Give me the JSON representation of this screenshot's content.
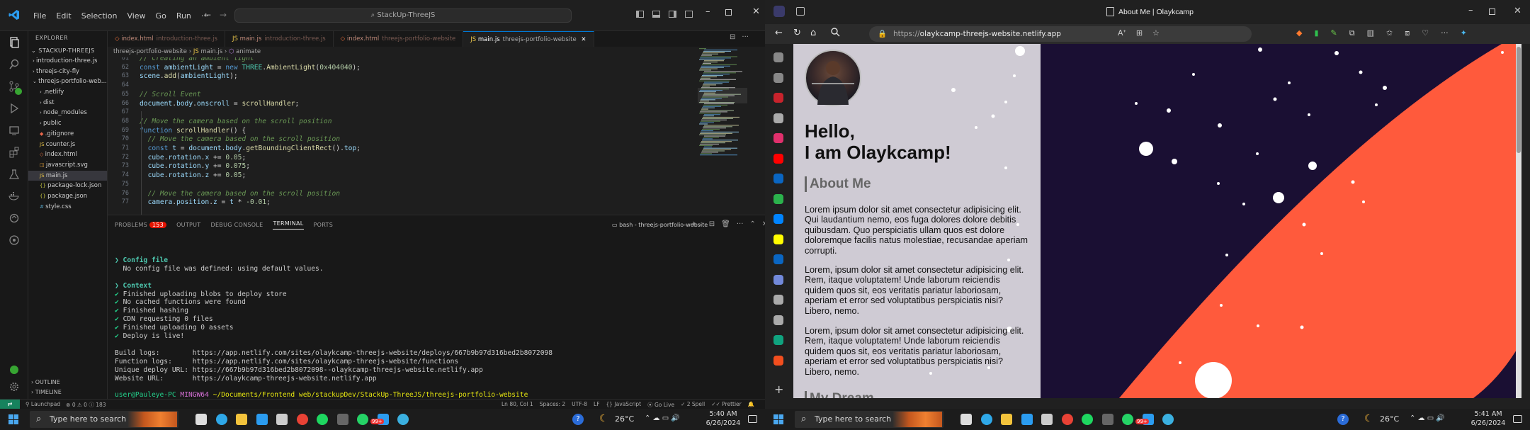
{
  "vscode": {
    "menu": [
      "File",
      "Edit",
      "Selection",
      "View",
      "Go",
      "Run"
    ],
    "more": "···",
    "command_center": "StackUp-ThreeJS",
    "explorer": {
      "title": "EXPLORER",
      "workspace": "STACKUP-THREEJS",
      "items": [
        {
          "label": "introduction-three.js",
          "kind": "folder",
          "depth": 0
        },
        {
          "label": "threejs-city-fly",
          "kind": "folder",
          "depth": 0
        },
        {
          "label": "threejs-portfolio-web...",
          "kind": "folder-open",
          "depth": 0
        },
        {
          "label": ".netlify",
          "kind": "folder",
          "depth": 1
        },
        {
          "label": "dist",
          "kind": "folder",
          "depth": 1
        },
        {
          "label": "node_modules",
          "kind": "folder",
          "depth": 1
        },
        {
          "label": "public",
          "kind": "folder",
          "depth": 1
        },
        {
          "label": ".gitignore",
          "kind": "file",
          "depth": 1
        },
        {
          "label": "counter.js",
          "kind": "js",
          "depth": 1
        },
        {
          "label": "index.html",
          "kind": "html",
          "depth": 1
        },
        {
          "label": "javascript.svg",
          "kind": "svg",
          "depth": 1
        },
        {
          "label": "main.js",
          "kind": "js",
          "depth": 1
        },
        {
          "label": "package-lock.json",
          "kind": "json",
          "depth": 1
        },
        {
          "label": "package.json",
          "kind": "json",
          "depth": 1
        },
        {
          "label": "style.css",
          "kind": "css",
          "depth": 1
        }
      ],
      "outline": "OUTLINE",
      "timeline": "TIMELINE"
    },
    "tabs": [
      {
        "name": "index.html",
        "folder": "introduction-three.js",
        "active": false
      },
      {
        "name": "main.js",
        "folder": "introduction-three.js",
        "active": false
      },
      {
        "name": "index.html",
        "folder": "threejs-portfolio-website",
        "active": false
      },
      {
        "name": "main.js",
        "folder": "threejs-portfolio-website",
        "active": true
      }
    ],
    "breadcrumb": [
      "threejs-portfolio-website",
      "main.js",
      "animate"
    ],
    "code_lines": [
      {
        "n": "61",
        "html": "<span class='cm'>// Creating an ambient light</span>"
      },
      {
        "n": "62",
        "html": "<span class='kw'>const</span> <span class='pr'>ambientLight</span> = <span class='kw'>new</span> <span class='cl'>THREE</span>.<span class='fn'>AmbientLight</span>(<span class='nm'>0x404040</span>);"
      },
      {
        "n": "63",
        "html": "<span class='pr'>scene</span>.<span class='fn'>add</span>(<span class='pr'>ambientLight</span>);"
      },
      {
        "n": "64",
        "html": ""
      },
      {
        "n": "65",
        "html": "<span class='cm'>// Scroll Event</span>"
      },
      {
        "n": "66",
        "html": "<span class='pr'>document</span>.<span class='pr'>body</span>.<span class='pr'>onscroll</span> = <span class='fn'>scrollHandler</span>;"
      },
      {
        "n": "67",
        "html": ""
      },
      {
        "n": "68",
        "html": "<span class='cm'>// Move the camera based on the scroll position</span>"
      },
      {
        "n": "69",
        "html": "<span class='kw'>function</span> <span class='fn'>scrollHandler</span>() {"
      },
      {
        "n": "70",
        "html": "  <span class='cm'>// Move the camera based on the scroll position</span>"
      },
      {
        "n": "71",
        "html": "  <span class='kw'>const</span> <span class='pr'>t</span> = <span class='pr'>document</span>.<span class='pr'>body</span>.<span class='fn'>getBoundingClientRect</span>().<span class='pr'>top</span>;"
      },
      {
        "n": "72",
        "html": "  <span class='pr'>cube</span>.<span class='pr'>rotation</span>.<span class='pr'>x</span> += <span class='nm'>0.05</span>;"
      },
      {
        "n": "73",
        "html": "  <span class='pr'>cube</span>.<span class='pr'>rotation</span>.<span class='pr'>y</span> += <span class='nm'>0.075</span>;"
      },
      {
        "n": "74",
        "html": "  <span class='pr'>cube</span>.<span class='pr'>rotation</span>.<span class='pr'>z</span> += <span class='nm'>0.05</span>;"
      },
      {
        "n": "75",
        "html": ""
      },
      {
        "n": "76",
        "html": "  <span class='cm'>// Move the camera based on the scroll position</span>"
      },
      {
        "n": "77",
        "html": "  <span class='pr'>camera</span>.<span class='pr'>position</span>.<span class='pr'>z</span> = <span class='pr'>t</span> * <span class='nm'>-0.01</span>;"
      }
    ],
    "panel_tabs": {
      "problems": "PROBLEMS",
      "problems_count": "153",
      "output": "OUTPUT",
      "debug": "DEBUG CONSOLE",
      "terminal": "TERMINAL",
      "ports": "PORTS"
    },
    "terminal_name": "bash - threejs-portfolio-website",
    "terminal": {
      "h1": "❯ Config file",
      "l1": "  No config file was defined: using default values.",
      "h2": "❯ Context",
      "checks": [
        "Finished uploading blobs to deploy store",
        "No cached functions were found",
        "Finished hashing",
        "CDN requesting 0 files",
        "Finished uploading 0 assets",
        "Deploy is live!"
      ],
      "build_label": "Build logs:        ",
      "build": "https://app.netlify.com/sites/olaykcamp-threejs-website/deploys/667b9b97d316bed2b8072098",
      "func_label": "Function logs:     ",
      "func": "https://app.netlify.com/sites/olaykcamp-threejs-website/functions",
      "uniq_label": "Unique deploy URL: ",
      "uniq": "https://667b9b97d316bed2b8072098--olaykcamp-threejs-website.netlify.app",
      "web_label": "Website URL:       ",
      "web": "https://olaykcamp-threejs-website.netlify.app",
      "prompt_user": "user@Pauleye-PC",
      "prompt_env": "MINGW64",
      "prompt_path": "~/Documents/Frontend web/stackupDev/StackUp-ThreeJS/threejs-portfolio-website",
      "prompt_sym": "$"
    },
    "status": {
      "launchpad": "Launchpad",
      "errors": "0",
      "warnings": "0",
      "info": "183",
      "pos": "Ln 80, Col 1",
      "spaces": "Spaces: 2",
      "enc": "UTF-8",
      "eol": "LF",
      "lang": "JavaScript",
      "golive": "Go Live",
      "spell": "2 Spell",
      "prettier": "Prettier"
    }
  },
  "edge": {
    "tab_title": "About Me | Olaykcamp",
    "url_prefix": "https://",
    "url_host": "olaykcamp-threejs-website.netlify.app",
    "page": {
      "hello": "Hello,",
      "iam": "I am Olaykcamp!",
      "about": "About Me",
      "p1": "Lorem ipsum dolor sit amet consectetur adipisicing elit. Qui laudantium nemo, eos fuga dolores dolore debitis quibusdam. Quo perspiciatis ullam quos est dolore doloremque facilis natus molestiae, recusandae aperiam corrupti.",
      "p2": "Lorem, ipsum dolor sit amet consectetur adipisicing elit. Rem, itaque voluptatem! Unde laborum reiciendis quidem quos sit, eos veritatis pariatur laboriosam, aperiam et error sed voluptatibus perspiciatis nisi? Libero, nemo.",
      "p3": "Lorem, ipsum dolor sit amet consectetur adipisicing elit. Rem, itaque voluptatem! Unde laborum reiciendis quidem quos sit, eos veritatis pariatur laboriosam, aperiam et error sed voluptatibus perspiciatis nisi? Libero, nemo.",
      "next": "My Dream"
    },
    "colors": {
      "planet": "#ff5a3c",
      "space": "#1a0f33",
      "panel": "#cfcbd4"
    }
  },
  "taskbar": {
    "search": "Type here to search",
    "left": {
      "temp": "26°C",
      "time": "5:40 AM",
      "date": "6/26/2024",
      "badge": "99+"
    },
    "right": {
      "temp": "26°C",
      "time": "5:41 AM",
      "date": "6/26/2024",
      "badge": "99+"
    }
  }
}
